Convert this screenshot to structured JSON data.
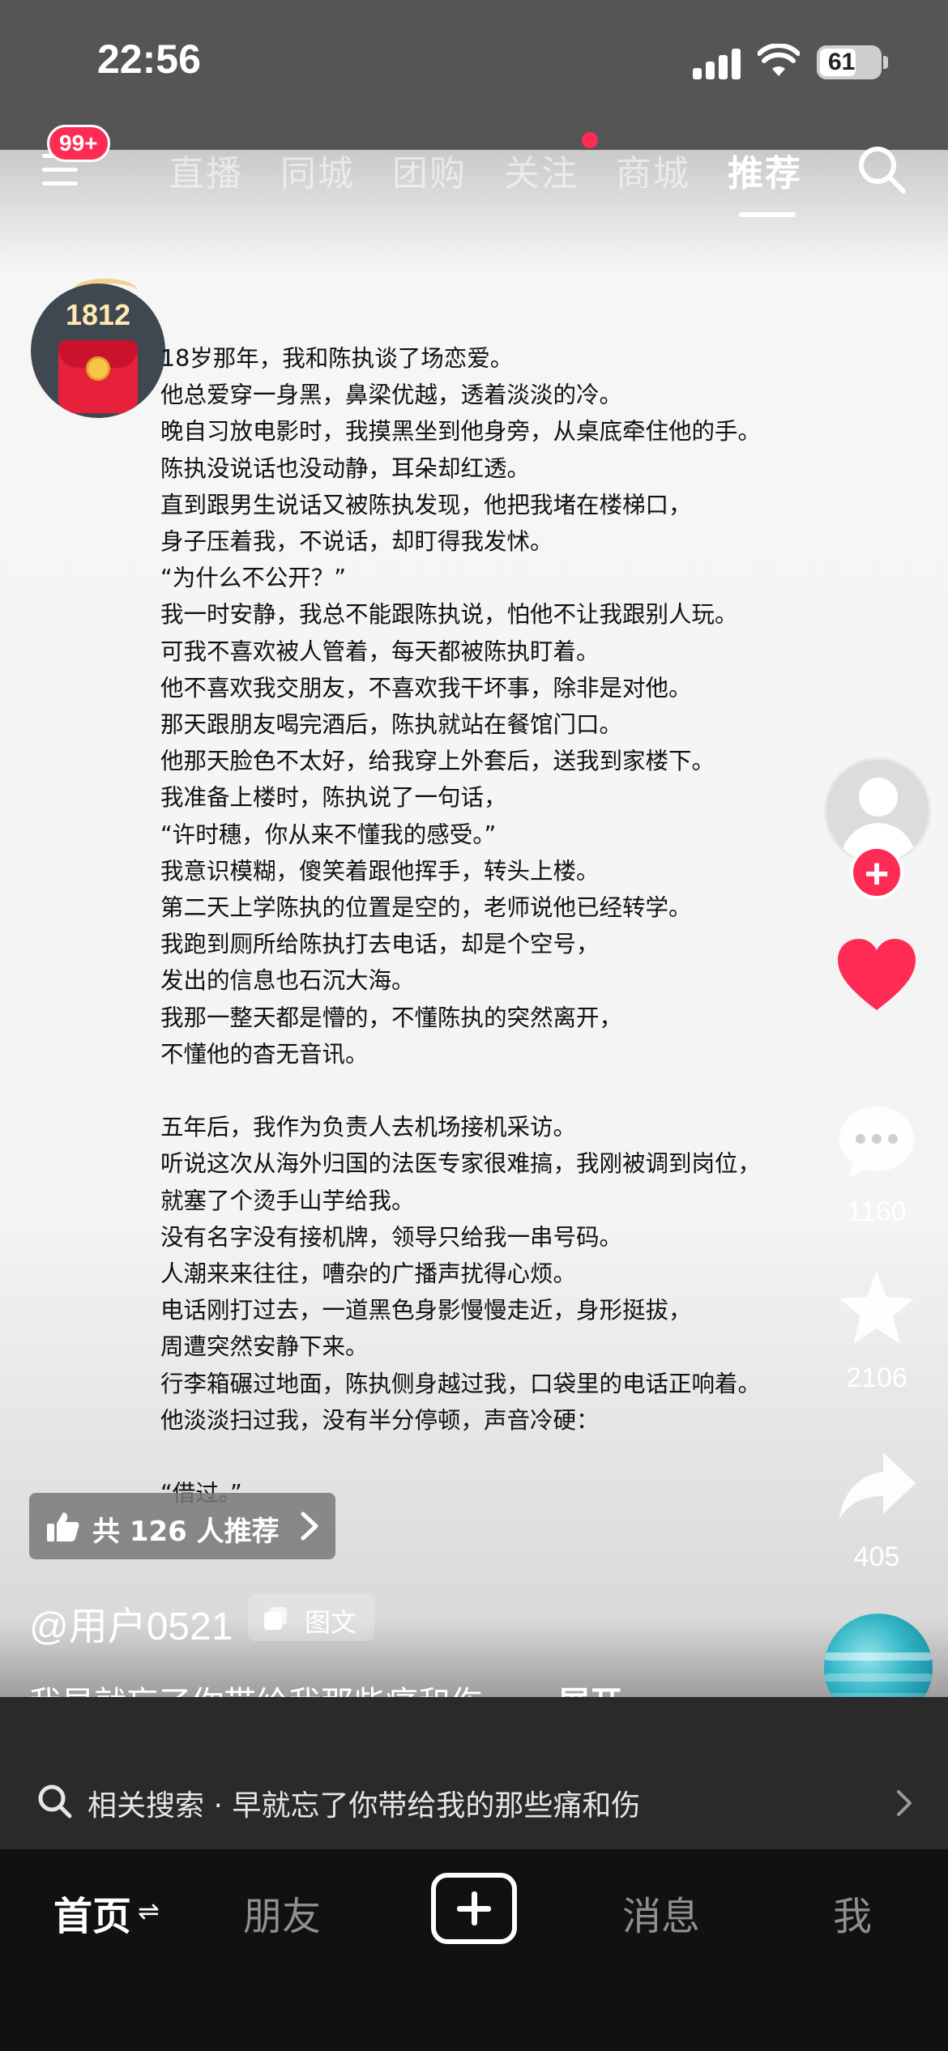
{
  "status_bar": {
    "time": "22:56",
    "battery": "61",
    "battery_level": 0.61
  },
  "top_nav": {
    "badge": "99+",
    "tabs": [
      "直播",
      "同城",
      "团购",
      "关注",
      "商城",
      "推荐"
    ],
    "active_tab": "推荐"
  },
  "author": {
    "count": "1812"
  },
  "story_lines": [
    "18岁那年，我和陈执谈了场恋爱。",
    "他总爱穿一身黑，鼻梁优越，透着淡淡的冷。",
    "晚自习放电影时，我摸黑坐到他身旁，从桌底牵住他的手。",
    "陈执没说话也没动静，耳朵却红透。",
    "直到跟男生说话又被陈执发现，他把我堵在楼梯口，",
    "身子压着我，不说话，却盯得我发怵。",
    "“为什么不公开？”",
    "我一时安静，我总不能跟陈执说，怕他不让我跟别人玩。",
    "可我不喜欢被人管着，每天都被陈执盯着。",
    "他不喜欢我交朋友，不喜欢我干坏事，除非是对他。",
    "那天跟朋友喝完酒后，陈执就站在餐馆门口。",
    "他那天脸色不太好，给我穿上外套后，送我到家楼下。",
    "我准备上楼时，陈执说了一句话，",
    "“许时穗，你从来不懂我的感受。”",
    "我意识模糊，傻笑着跟他挥手，转头上楼。",
    "第二天上学陈执的位置是空的，老师说他已经转学。",
    "我跑到厕所给陈执打去电话，却是个空号，",
    "发出的信息也石沉大海。",
    "我那一整天都是懵的，不懂陈执的突然离开，",
    "不懂他的杳无音讯。",
    "",
    "五年后，我作为负责人去机场接机采访。",
    "听说这次从海外归国的法医专家很难搞，我刚被调到岗位，",
    "就塞了个烫手山芋给我。",
    "没有名字没有接机牌，领导只给我一串号码。",
    "人潮来来往往，嘈杂的广播声扰得心烦。",
    "电话刚打过去，一道黑色身影慢慢走近，身形挺拔，",
    "周遭突然安静下来。",
    "行李箱碾过地面，陈执侧身越过我，口袋里的电话正响着。",
    "他淡淡扫过我，没有半分停顿，声音冷硬：",
    "",
    "“借过。”"
  ],
  "actions": {
    "comments": "1160",
    "favorites": "2106",
    "shares": "405"
  },
  "recommend": {
    "label": "共 126 人推荐"
  },
  "post": {
    "username": "@用户0521",
    "type_tag": "图文",
    "caption": "我早就忘了你带给我那些痛和伤。...",
    "expand": "展开"
  },
  "related_search": {
    "text": "相关搜索 · 早就忘了你带给我的那些痛和伤"
  },
  "bottom_tabs": {
    "home": "首页",
    "friends": "朋友",
    "messages": "消息",
    "me": "我",
    "swap_glyph": "⇌"
  },
  "colors": {
    "accent": "#fe2c55",
    "tabbar": "#111111"
  }
}
